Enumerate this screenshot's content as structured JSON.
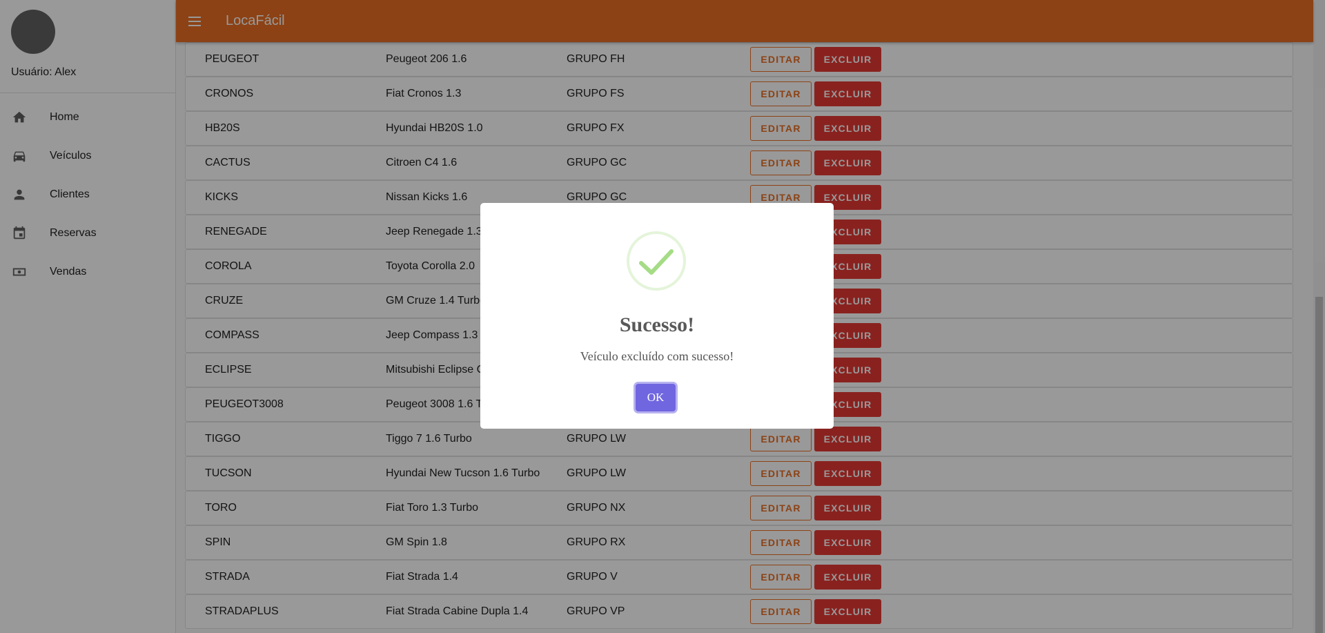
{
  "app": {
    "title": "LocaFácil"
  },
  "sidebar": {
    "user_label": "Usuário: Alex",
    "items": [
      {
        "label": "Home",
        "icon": "home-icon"
      },
      {
        "label": "Veículos",
        "icon": "car-icon"
      },
      {
        "label": "Clientes",
        "icon": "person-icon"
      },
      {
        "label": "Reservas",
        "icon": "calendar-icon"
      },
      {
        "label": "Vendas",
        "icon": "cash-icon"
      }
    ]
  },
  "table": {
    "edit_label": "EDITAR",
    "delete_label": "EXCLUIR",
    "rows": [
      {
        "code": "PEUGEOT",
        "model": "Peugeot 206 1.6",
        "group": "GRUPO FH"
      },
      {
        "code": "CRONOS",
        "model": "Fiat Cronos 1.3",
        "group": "GRUPO FS"
      },
      {
        "code": "HB20S",
        "model": "Hyundai HB20S 1.0",
        "group": "GRUPO FX"
      },
      {
        "code": "CACTUS",
        "model": "Citroen C4 1.6",
        "group": "GRUPO GC"
      },
      {
        "code": "KICKS",
        "model": "Nissan Kicks 1.6",
        "group": "GRUPO GC"
      },
      {
        "code": "RENEGADE",
        "model": "Jeep Renegade 1.3",
        "group": ""
      },
      {
        "code": "COROLA",
        "model": "Toyota Corolla 2.0",
        "group": ""
      },
      {
        "code": "CRUZE",
        "model": "GM Cruze 1.4 Turbo",
        "group": ""
      },
      {
        "code": "COMPASS",
        "model": "Jeep Compass 1.3",
        "group": ""
      },
      {
        "code": "ECLIPSE",
        "model": "Mitsubishi Eclipse C",
        "group": ""
      },
      {
        "code": "PEUGEOT3008",
        "model": "Peugeot 3008 1.6 T",
        "group": ""
      },
      {
        "code": "TIGGO",
        "model": "Tiggo 7 1.6 Turbo",
        "group": "GRUPO LW"
      },
      {
        "code": "TUCSON",
        "model": "Hyundai New Tucson 1.6 Turbo",
        "group": "GRUPO LW"
      },
      {
        "code": "TORO",
        "model": "Fiat Toro 1.3 Turbo",
        "group": "GRUPO NX"
      },
      {
        "code": "SPIN",
        "model": "GM Spin 1.8",
        "group": "GRUPO RX"
      },
      {
        "code": "STRADA",
        "model": "Fiat Strada 1.4",
        "group": "GRUPO V"
      },
      {
        "code": "STRADAPLUS",
        "model": "Fiat Strada Cabine Dupla 1.4",
        "group": "GRUPO VP"
      }
    ]
  },
  "modal": {
    "title": "Sucesso!",
    "message": "Veículo excluído com sucesso!",
    "ok_label": "OK",
    "icon": "success-check-icon"
  },
  "colors": {
    "primary": "#e96e24",
    "danger": "#e53935",
    "confirm": "#7066e0",
    "success": "#a5dc86"
  }
}
